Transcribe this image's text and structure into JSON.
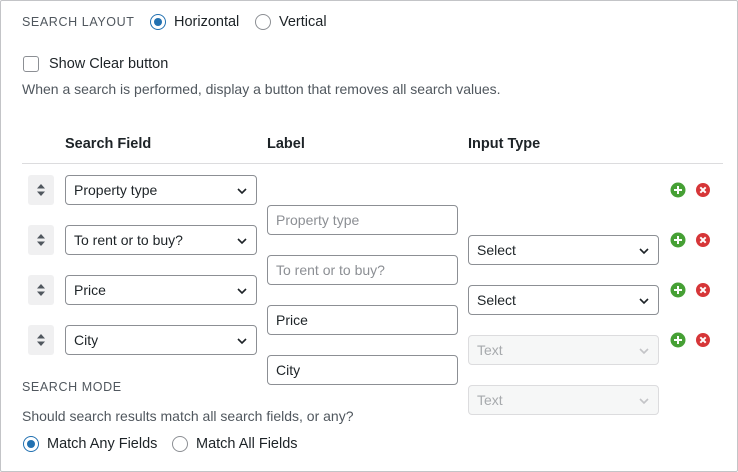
{
  "search_layout": {
    "label": "SEARCH LAYOUT",
    "options": [
      {
        "label": "Horizontal",
        "checked": true
      },
      {
        "label": "Vertical",
        "checked": false
      }
    ]
  },
  "show_clear": {
    "label": "Show Clear button",
    "checked": false,
    "description": "When a search is performed, display a button that removes all search values."
  },
  "table": {
    "headers": {
      "search_field": "Search Field",
      "label": "Label",
      "input_type": "Input Type"
    },
    "rows": [
      {
        "search_field": "Property type",
        "label_placeholder": "Property type",
        "input_type": "Select",
        "input_type_disabled": false
      },
      {
        "search_field": "To rent or to buy?",
        "label_placeholder": "To rent or to buy?",
        "input_type": "Select",
        "input_type_disabled": false
      },
      {
        "search_field": "Price",
        "label_placeholder": "Price",
        "input_type": "Text",
        "input_type_disabled": true
      },
      {
        "search_field": "City",
        "label_placeholder": "City",
        "input_type": "Text",
        "input_type_disabled": true
      }
    ]
  },
  "search_mode": {
    "label": "SEARCH MODE",
    "description": "Should search results match all search fields, or any?",
    "options": [
      {
        "label": "Match Any Fields",
        "checked": true
      },
      {
        "label": "Match All Fields",
        "checked": false
      }
    ]
  },
  "colors": {
    "accent": "#2271b1",
    "add": "#46a035",
    "remove": "#d63638"
  },
  "icons": {
    "drag": "sort-arrows-icon",
    "add": "plus-circle-icon",
    "remove": "x-circle-icon",
    "caret": "chevron-down-icon"
  }
}
